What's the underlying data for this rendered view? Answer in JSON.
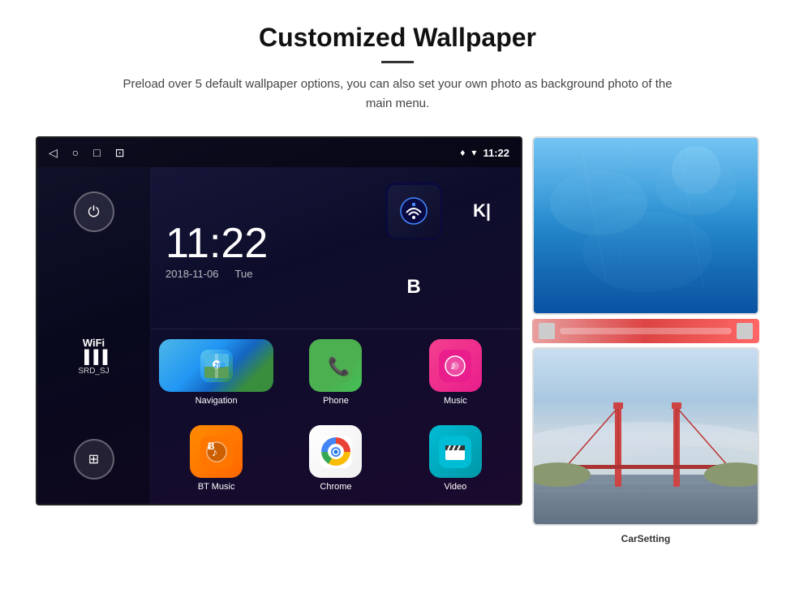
{
  "header": {
    "title": "Customized Wallpaper",
    "subtitle": "Preload over 5 default wallpaper options, you can also set your own photo as background photo of the main menu."
  },
  "screen": {
    "status_bar": {
      "time": "11:22",
      "icons": [
        "◁",
        "○",
        "□",
        "⊡"
      ]
    },
    "clock": {
      "time": "11:22",
      "date": "2018-11-06",
      "day": "Tue"
    },
    "sidebar": {
      "wifi_label": "WiFi",
      "wifi_network": "SRD_SJ"
    },
    "apps": [
      {
        "id": "navigation",
        "label": "Navigation",
        "icon": "🗺"
      },
      {
        "id": "phone",
        "label": "Phone",
        "icon": "📞"
      },
      {
        "id": "music",
        "label": "Music",
        "icon": "🎵"
      },
      {
        "id": "bt_music",
        "label": "BT Music",
        "icon": "🎧"
      },
      {
        "id": "chrome",
        "label": "Chrome",
        "icon": "chrome"
      },
      {
        "id": "video",
        "label": "Video",
        "icon": "🎬"
      }
    ],
    "right_widgets": [
      {
        "id": "signal",
        "label": "Signal"
      },
      {
        "id": "ki",
        "label": "KI"
      },
      {
        "id": "b",
        "label": "B"
      }
    ]
  },
  "wallpapers": [
    {
      "id": "ice",
      "label": "Ice Cavern"
    },
    {
      "id": "bridge",
      "label": "Golden Gate"
    }
  ],
  "car_setting_label": "CarSetting"
}
